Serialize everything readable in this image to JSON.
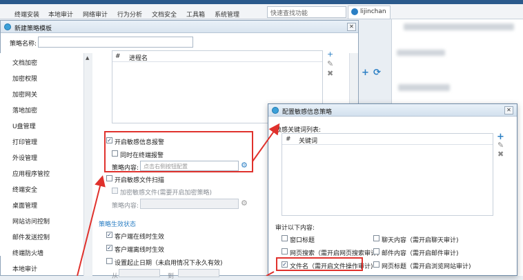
{
  "menubar": {
    "items": [
      "终端安装",
      "本地审计",
      "网络审计",
      "行为分析",
      "文档安全",
      "工具箱",
      "系统管理"
    ],
    "search_placeholder": "快速查找功能",
    "user": "lijinchan"
  },
  "main_window": {
    "title": "新建策略模板",
    "strategy_name_label": "策略名称:",
    "nav_items": [
      "文档加密",
      "加密权限",
      "加密网关",
      "落地加密",
      "U盘管理",
      "打印管理",
      "外设管理",
      "应用程序管控",
      "终端安全",
      "桌面管理",
      "网站访问控制",
      "邮件发送控制",
      "终端防火墙",
      "本地审计"
    ],
    "process_list": {
      "col_index": "#",
      "col_name": "进程名"
    },
    "options": {
      "enable_sensitive_alert": "开启敏感信息报警",
      "sync_terminal_alert": "同时在终端报警",
      "policy_content_label": "策略内容:",
      "policy_content_placeholder": "点击右侧按钮配置",
      "enable_file_scan": "开启敏感文件扫描",
      "encrypt_sensitive_file": "加密敏感文件(需要开启加密策略)",
      "policy_content_label_2": "策略内容:"
    },
    "effective_state": {
      "section_title": "策略生效状态",
      "online": "客户端在线时生效",
      "offline": "客户端离线时生效",
      "date_range": "设置起止日期（未启用情况下永久有效)",
      "from": "从",
      "to": "到"
    }
  },
  "config_window": {
    "title": "配置敏感信息策略",
    "keyword_list_label": "敏感关键词列表:",
    "kw_col_index": "#",
    "kw_col_name": "关键词",
    "audit_label": "审计以下内容:",
    "audit_items": [
      {
        "label": "窗口标题",
        "checked": false
      },
      {
        "label": "聊天内容（需开启聊天审计)",
        "checked": false
      },
      {
        "label": "网页搜索（需开启网页搜索审计)",
        "checked": false
      },
      {
        "label": "邮件内容（需开启邮件审计)",
        "checked": false
      },
      {
        "label": "文件名（需开启文件操作审计)",
        "checked": true
      },
      {
        "label": "网页标题（需开启浏览网站审计)",
        "checked": false
      }
    ]
  },
  "icons": {
    "plus": "+",
    "pencil": "✎",
    "delete": "✖",
    "gear": "⚙",
    "check": "✓",
    "close": "✕",
    "refresh": "⟳",
    "scroll_up": "▲",
    "scroll_down": "▼",
    "dropdown": "▾"
  },
  "colors": {
    "accent": "#2b7fc4",
    "annotation_red": "#e0312c"
  }
}
